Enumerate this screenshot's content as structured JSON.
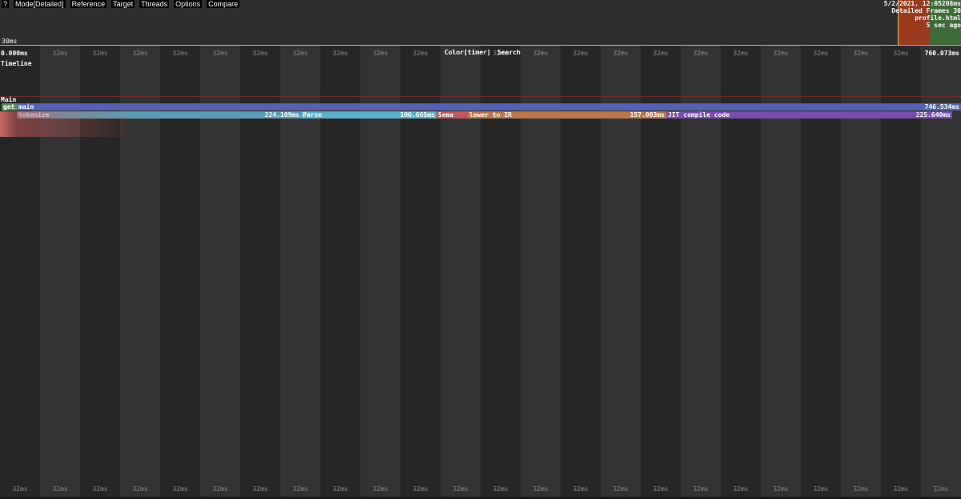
{
  "menu": {
    "help": "?",
    "mode": "Mode[Detailed]",
    "reference": "Reference",
    "target": "Target",
    "threads": "Threads",
    "options": "Options",
    "compare": "Compare"
  },
  "summary": {
    "scale_label": "30ms",
    "info_line1": "5/2/2021, 12:05208ms",
    "info_line2": "Detailed Frames 30",
    "info_line3": "profile.html",
    "info_line4": "5 sec ago"
  },
  "timeline": {
    "range_start": "0.000ms",
    "range_end": "760.073ms",
    "color_mode": "Color[timer]",
    "search_label": "Search",
    "section_label": "Timeline",
    "thread_label": "Main",
    "tick_label": "32ms",
    "ticks_top": [
      "32ms",
      "32ms",
      "32ms",
      "32ms",
      "32ms",
      "32ms",
      "32ms",
      "32ms",
      "32ms",
      "32ms",
      "32ms",
      "32ms",
      "32ms",
      "32ms",
      "32ms",
      "32ms",
      "32ms",
      "32ms",
      "32ms",
      "32ms",
      "32ms",
      "32ms"
    ],
    "ticks_bottom": [
      "32ms",
      "32ms",
      "32ms",
      "32ms",
      "32ms",
      "32ms",
      "32ms",
      "32ms",
      "32ms",
      "32ms",
      "32ms",
      "32ms",
      "32ms",
      "32ms",
      "32ms",
      "32ms",
      "32ms",
      "32ms",
      "32ms",
      "32ms",
      "32ms",
      "32ms",
      "32ms",
      "32ms"
    ]
  },
  "timers": {
    "get": {
      "label": "get",
      "color": "#5a8f5a"
    },
    "main": {
      "label": "main",
      "duration": "746.534ms",
      "color": "#5563b0"
    },
    "tokenize": {
      "label": "tokenize",
      "duration": "224.109ms",
      "color": "#5a9bb5"
    },
    "parse": {
      "label": "Parse",
      "duration": "106.665ms",
      "color": "#5bb0c8"
    },
    "sema": {
      "label": "Sema",
      "color": "#c0555f"
    },
    "lower": {
      "label": "lower to IR",
      "duration": "157.003ms",
      "color": "#b9754e"
    },
    "jit": {
      "label": "JIT compile code",
      "duration": "225.640ms",
      "color": "#7a4bb3"
    }
  }
}
